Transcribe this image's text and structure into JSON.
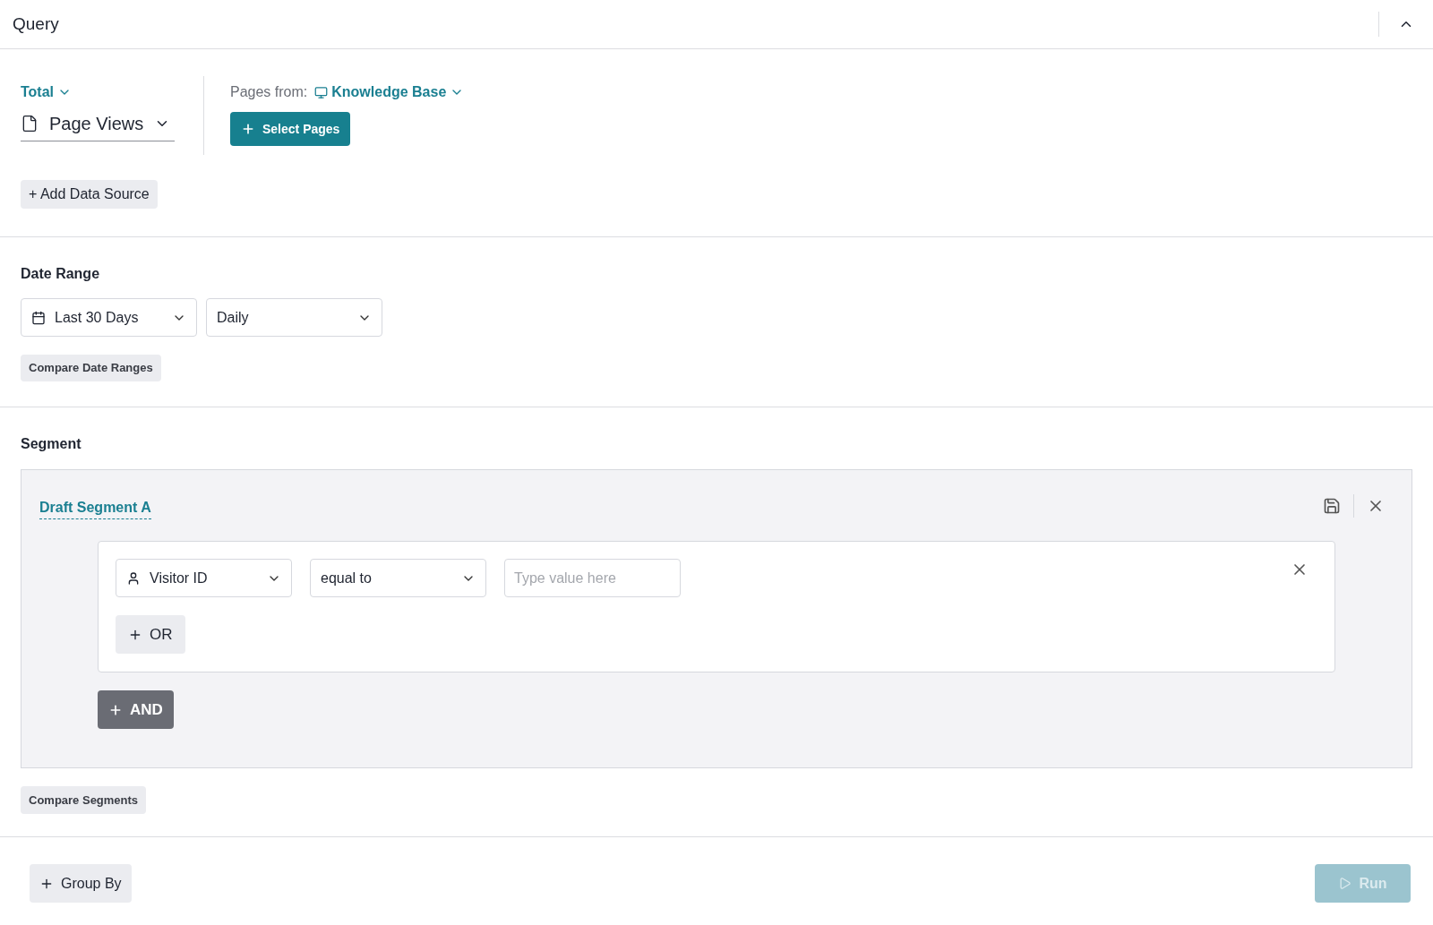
{
  "header": {
    "title": "Query",
    "collapsed": false
  },
  "data_source": {
    "aggregation": "Total",
    "metric": "Page Views",
    "pages_from_label": "Pages from:",
    "pages_from_value": "Knowledge Base",
    "select_pages_button": "Select Pages",
    "add_button": "+ Add Data Source"
  },
  "date_range": {
    "label": "Date Range",
    "range": "Last 30 Days",
    "interval": "Daily",
    "compare_button": "Compare Date Ranges"
  },
  "segment": {
    "label": "Segment",
    "name": "Draft Segment A",
    "conditions": [
      {
        "field": "Visitor ID",
        "operator": "equal to",
        "placeholder": "Type value here"
      }
    ],
    "or_button": "OR",
    "and_button": "AND",
    "compare_button": "Compare Segments"
  },
  "footer": {
    "group_by_button": "Group By",
    "run_button": {
      "label": "Run",
      "disabled": true
    }
  }
}
